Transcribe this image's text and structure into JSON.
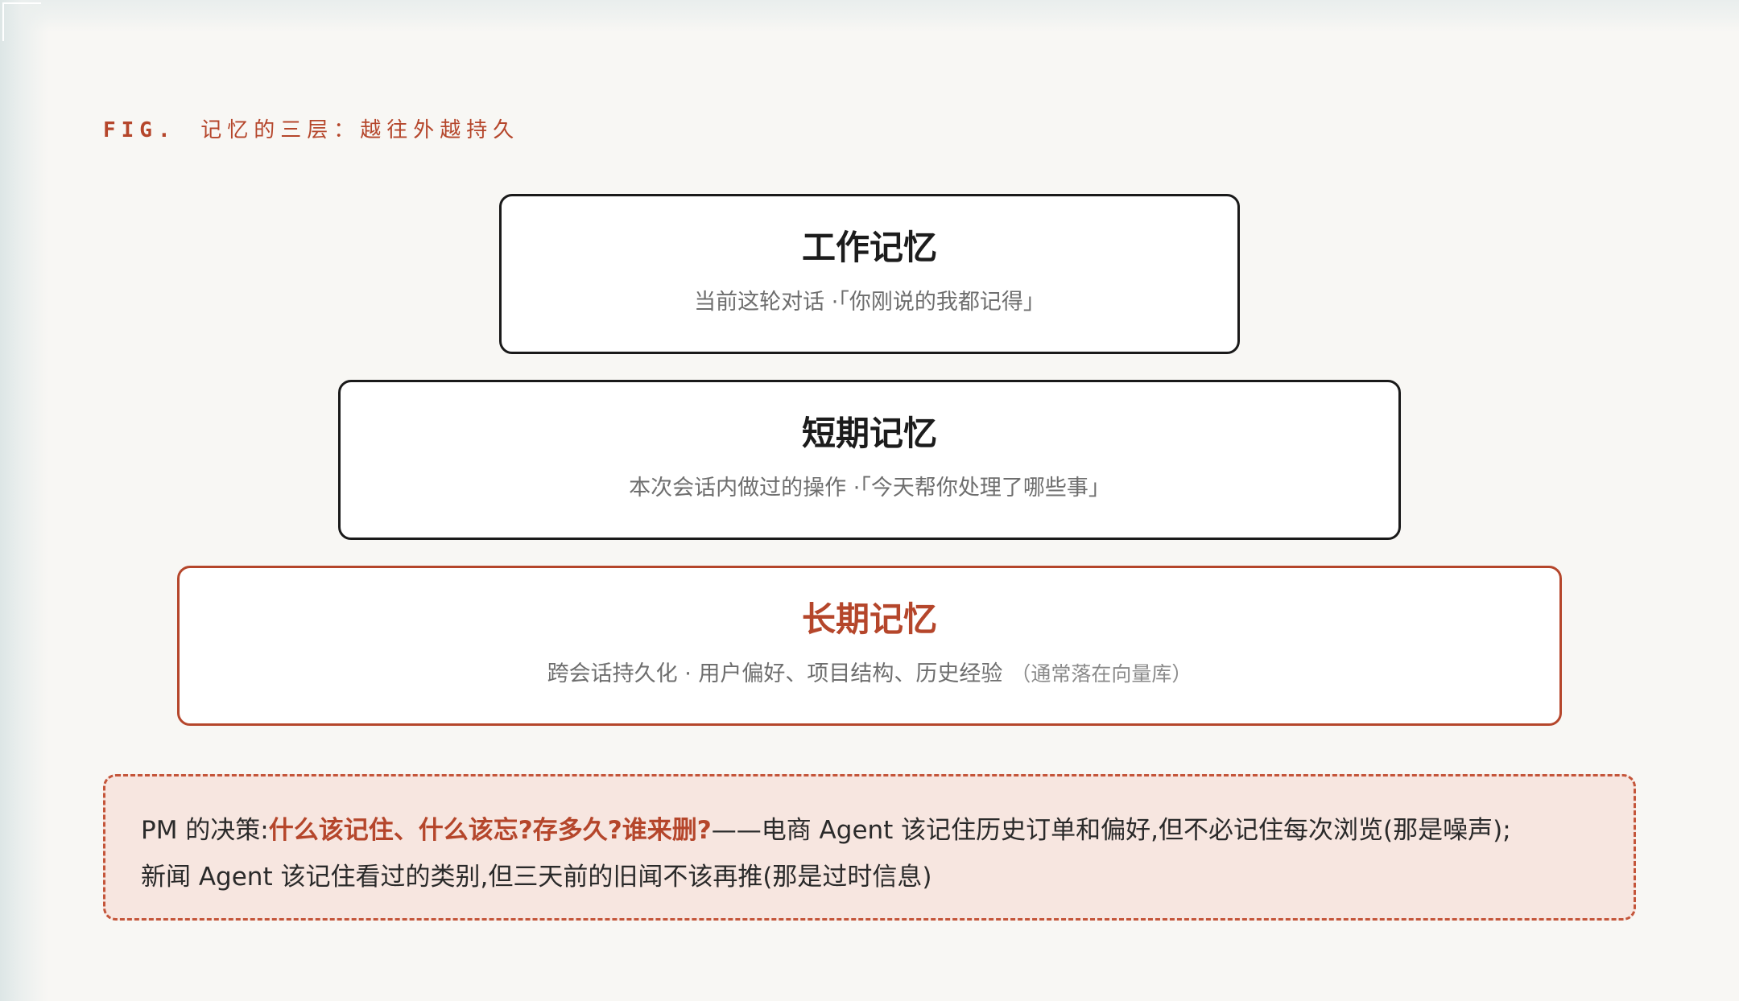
{
  "figure": {
    "label": "FIG.",
    "caption": "记忆的三层：越往外越持久"
  },
  "layers": [
    {
      "title": "工作记忆",
      "description": "当前这轮对话 ·「你刚说的我都记得」",
      "note": ""
    },
    {
      "title": "短期记忆",
      "description": "本次会话内做过的操作 ·「今天帮你处理了哪些事」",
      "note": ""
    },
    {
      "title": "长期记忆",
      "description": "跨会话持久化 · 用户偏好、项目结构、历史经验",
      "note": "（通常落在向量库）"
    }
  ],
  "pm_note": {
    "prefix": "PM 的决策:",
    "emphasis": "什么该记住、什么该忘?存多久?谁来删?",
    "line1_rest": "——电商 Agent 该记住历史订单和偏好,但不必记住每次浏览(那是噪声);",
    "line2": "新闻 Agent 该记住看过的类别,但三天前的旧闻不该再推(那是过时信息)"
  },
  "colors": {
    "accent": "#b5462b",
    "border_dark": "#1a1a1a",
    "note_background": "#f7e6e0",
    "page_background": "#f8f7f4"
  }
}
